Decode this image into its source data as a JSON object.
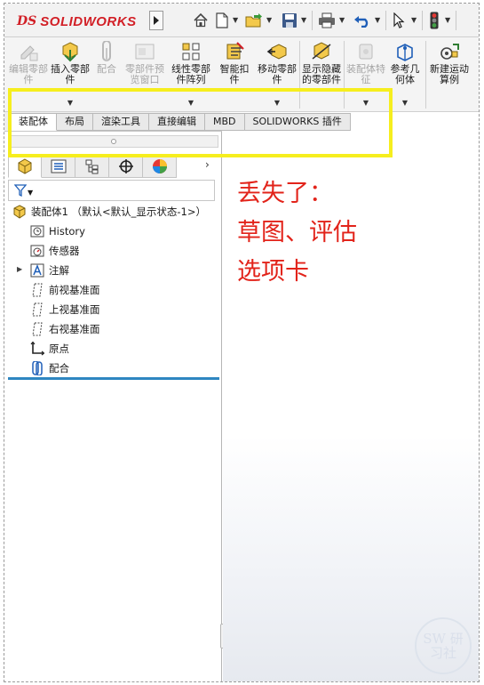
{
  "app": {
    "logo_ds": "DS",
    "logo_name": "SOLIDWORKS"
  },
  "quick_access": [
    "home-icon",
    "new-document-icon",
    "open-icon",
    "save-icon",
    "print-icon",
    "undo-icon",
    "select-pointer-icon",
    "traffic-light-icon"
  ],
  "commands": [
    {
      "label": "编辑零部件",
      "icon": "edit-component-icon",
      "enabled": false
    },
    {
      "label": "插入零部件",
      "icon": "insert-components-icon",
      "enabled": true
    },
    {
      "label": "配合",
      "icon": "mate-icon",
      "enabled": false
    },
    {
      "label": "零部件预览窗口",
      "icon": "component-preview-icon",
      "enabled": false
    },
    {
      "label": "线性零部件阵列",
      "icon": "linear-pattern-icon",
      "enabled": true
    },
    {
      "label": "智能扣件",
      "icon": "smart-fasteners-icon",
      "enabled": true
    },
    {
      "label": "移动零部件",
      "icon": "move-component-icon",
      "enabled": true
    },
    {
      "label": "显示隐藏的零部件",
      "icon": "show-hidden-icon",
      "enabled": true
    },
    {
      "label": "装配体特征",
      "icon": "assembly-features-icon",
      "enabled": false
    },
    {
      "label": "参考几何体",
      "icon": "reference-geometry-icon",
      "enabled": true
    },
    {
      "label": "新建运动算例",
      "icon": "new-motion-study-icon",
      "enabled": true
    }
  ],
  "tabs": [
    "装配体",
    "布局",
    "渲染工具",
    "直接编辑",
    "MBD",
    "SOLIDWORKS 插件"
  ],
  "active_tab": "装配体",
  "manager_tabs": [
    "feature-manager-icon",
    "property-manager-icon",
    "configuration-manager-icon",
    "dimxpert-icon",
    "display-manager-icon"
  ],
  "tree": {
    "root": "装配体1 （默认<默认_显示状态-1>）",
    "items": [
      {
        "label": "History",
        "icon": "history-icon",
        "expandable": false
      },
      {
        "label": "传感器",
        "icon": "sensors-icon",
        "expandable": false
      },
      {
        "label": "注解",
        "icon": "annotations-icon",
        "expandable": true
      },
      {
        "label": "前视基准面",
        "icon": "plane-icon",
        "expandable": false
      },
      {
        "label": "上视基准面",
        "icon": "plane-icon",
        "expandable": false
      },
      {
        "label": "右视基准面",
        "icon": "plane-icon",
        "expandable": false
      },
      {
        "label": "原点",
        "icon": "origin-icon",
        "expandable": false
      },
      {
        "label": "配合",
        "icon": "mates-folder-icon",
        "expandable": false
      }
    ]
  },
  "annotation": {
    "line1": "丢失了：",
    "line2": "草图、评估",
    "line3": "选项卡",
    "color": "#e2231a"
  },
  "watermark": "SW\n研习社",
  "colors": {
    "brand": "#d21f26",
    "highlight": "#f6ee1e",
    "tree_end_bar": "#2e86c1"
  }
}
